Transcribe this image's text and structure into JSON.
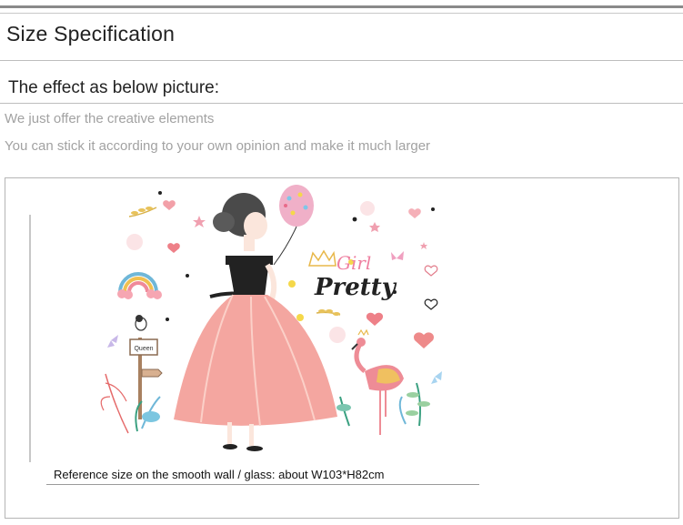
{
  "header": {
    "title": "Size Specification"
  },
  "section": {
    "subtitle": "The effect as below picture:",
    "notes": [
      "We just offer the creative elements",
      "You can stick it according to your own opinion and make it much larger"
    ]
  },
  "illustration": {
    "lettering": [
      "Girl",
      "Pretty"
    ],
    "sign_text": "Queen",
    "caption": "Reference size on the smooth wall / glass: about W103*H82cm"
  },
  "colors": {
    "text_dark": "#222222",
    "text_muted": "#a2a2a2",
    "dress_pink": "#f4a6a0",
    "flamingo_pink": "#ee8c96",
    "accent_gold": "#e8b84a",
    "rainbow_blue": "#6fb7d8"
  }
}
